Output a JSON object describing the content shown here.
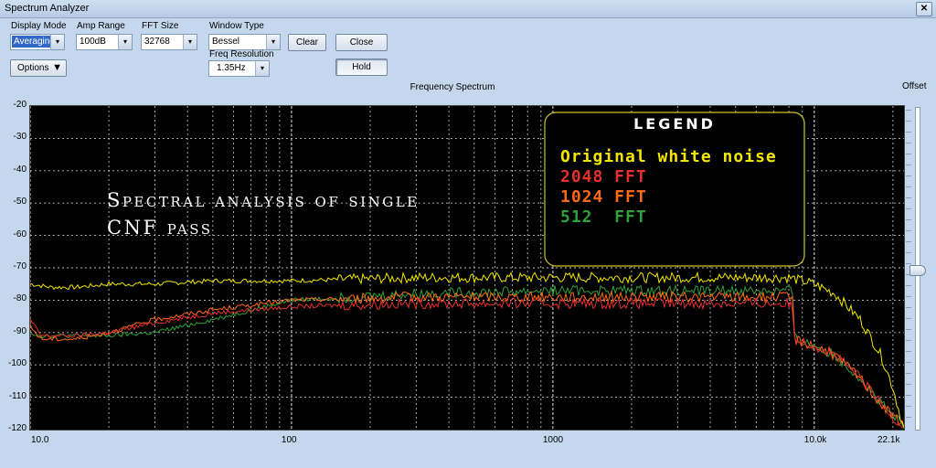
{
  "window": {
    "title": "Spectrum Analyzer",
    "close_glyph": "✕"
  },
  "controls": {
    "display_mode": {
      "label": "Display Mode",
      "value": "Averaging"
    },
    "amp_range": {
      "label": "Amp Range",
      "value": "100dB"
    },
    "fft_size": {
      "label": "FFT Size",
      "value": "32768"
    },
    "window_type": {
      "label": "Window Type",
      "value": "Bessel"
    },
    "freq_resolution": {
      "label": "Freq Resolution",
      "value": "1.35Hz"
    },
    "clear_label": "Clear",
    "close_label": "Close",
    "hold_label": "Hold",
    "options_label": "Options",
    "dropdown_glyph": "▾",
    "options_glyph": "▼"
  },
  "offset_label": "Offset",
  "chart_data": {
    "type": "line",
    "title": "Frequency Spectrum",
    "x_scale": "log",
    "xlim": [
      10,
      22050
    ],
    "ylim": [
      -120,
      -20
    ],
    "grid": true,
    "x_tick_labels": [
      "10.0",
      "100",
      "1000",
      "10.0k",
      "22.1k"
    ],
    "y_tick_labels": [
      "-20",
      "-30",
      "-40",
      "-50",
      "-60",
      "-70",
      "-80",
      "-90",
      "-100",
      "-110",
      "-120"
    ],
    "annotation": [
      "Spectral analysis of single",
      "CNF pass"
    ],
    "legend": {
      "heading": "LEGEND",
      "placement": "top-right",
      "entries": [
        {
          "label": "Original white noise",
          "color": "#f2e600"
        },
        {
          "label": "2048 FFT",
          "color": "#e53030"
        },
        {
          "label": "1024 FFT",
          "color": "#ff6a1a"
        },
        {
          "label": "512  FFT",
          "color": "#2fa03a"
        }
      ]
    },
    "series": [
      {
        "name": "Original white noise",
        "color": "#f2e600",
        "x": [
          10,
          12,
          15,
          20,
          30,
          50,
          100,
          300,
          1000,
          3000,
          7000,
          8000,
          10000,
          12000,
          15000,
          18000,
          20000,
          22050
        ],
        "y": [
          -75,
          -76,
          -76,
          -75,
          -75,
          -74,
          -74,
          -73,
          -73,
          -73,
          -73,
          -73,
          -75,
          -78,
          -86,
          -97,
          -107,
          -120
        ]
      },
      {
        "name": "2048 FFT",
        "color": "#e53030",
        "x": [
          10,
          11,
          15,
          20,
          30,
          50,
          100,
          300,
          1000,
          3000,
          7000,
          8000,
          8300,
          8400,
          10000,
          12000,
          15000,
          18000,
          20000,
          22050
        ],
        "y": [
          -86,
          -91,
          -91,
          -90,
          -87,
          -84,
          -82,
          -81,
          -81,
          -81,
          -81,
          -81,
          -83,
          -92,
          -94,
          -97,
          -104,
          -112,
          -116,
          -119
        ]
      },
      {
        "name": "1024 FFT",
        "color": "#ff6a1a",
        "x": [
          10,
          11,
          15,
          20,
          30,
          50,
          100,
          300,
          1000,
          3000,
          7000,
          8000,
          8300,
          8400,
          10000,
          12000,
          15000,
          18000,
          20000,
          22050
        ],
        "y": [
          -88,
          -92,
          -92,
          -90,
          -86,
          -83,
          -80,
          -79,
          -79,
          -79,
          -79,
          -79,
          -80,
          -92,
          -94,
          -97,
          -104,
          -112,
          -116,
          -119
        ]
      },
      {
        "name": "512  FFT",
        "color": "#2fa03a",
        "x": [
          10,
          11,
          15,
          20,
          30,
          50,
          100,
          300,
          1000,
          3000,
          7000,
          8000,
          8300,
          8400,
          10000,
          12000,
          15000,
          18000,
          20000,
          22050
        ],
        "y": [
          -90,
          -91,
          -91,
          -91,
          -90,
          -86,
          -80,
          -78,
          -77,
          -77,
          -77,
          -77,
          -78,
          -92,
          -94,
          -97,
          -104,
          -112,
          -116,
          -119
        ]
      }
    ]
  }
}
